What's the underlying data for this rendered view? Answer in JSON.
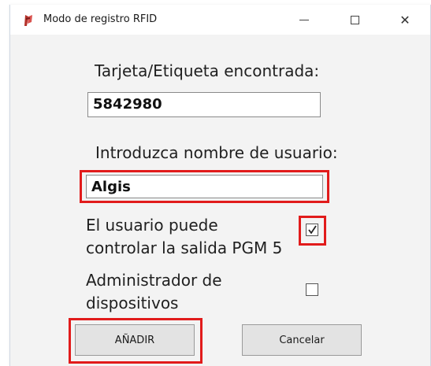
{
  "window": {
    "title": "Modo de registro RFID",
    "minimize_label": "—",
    "close_label": "✕"
  },
  "form": {
    "card_label": "Tarjeta/Etiqueta encontrada:",
    "card_value": "5842980",
    "username_label": "Introduzca nombre de usuario:",
    "username_value": "Algis",
    "pgm_label_line1": "El usuario puede",
    "pgm_label_line2": "controlar la salida PGM 5",
    "pgm_checked": true,
    "admin_label_line1": "Administrador de",
    "admin_label_line2": "dispositivos",
    "admin_checked": false
  },
  "buttons": {
    "add_label": "AÑADIR",
    "cancel_label": "Cancelar"
  },
  "colors": {
    "highlight": "#e11b1b",
    "background": "#f3f3f3"
  },
  "icons": [
    "app-icon",
    "minimize-icon",
    "maximize-icon",
    "close-icon",
    "checkmark-icon"
  ]
}
